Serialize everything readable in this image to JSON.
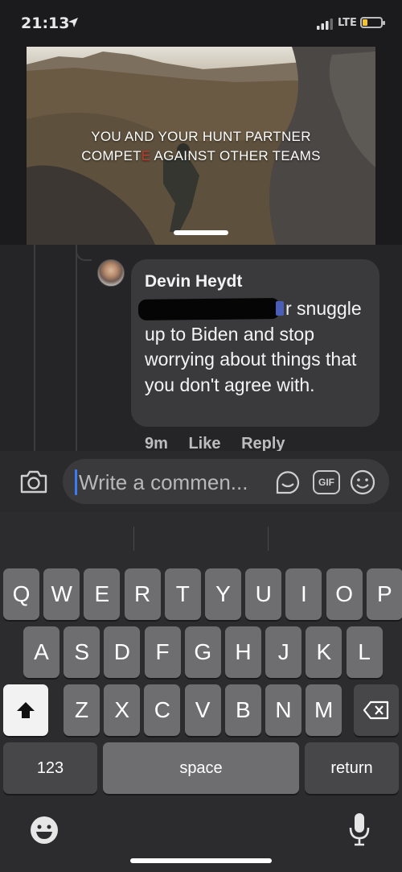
{
  "status": {
    "time": "21:13",
    "carrier": "LTE",
    "battery_level": 0.25,
    "battery_color": "#f3c42e",
    "location_icon": "location-arrow-icon",
    "signal_icon": "cell-signal-icon"
  },
  "video": {
    "caption_line1": "YOU AND YOUR HUNT PARTNER",
    "caption_line2_a": "COMPET",
    "caption_line2_red": "E",
    "caption_line2_b": " AGAINST OTHER TEAMS",
    "progress_fraction": 0.5
  },
  "comment": {
    "author": "Devin Heydt",
    "text": "r snuggle up to Biden and stop worrying about things that you don't agree with.",
    "time": "9m",
    "like_label": "Like",
    "reply_label": "Reply"
  },
  "composer": {
    "placeholder": "Write a commen...",
    "gif_label": "GIF",
    "camera_icon": "camera-icon",
    "sticker_icon": "sticker-icon",
    "emoji_icon": "smiley-icon"
  },
  "keyboard": {
    "row1": [
      "Q",
      "W",
      "E",
      "R",
      "T",
      "Y",
      "U",
      "I",
      "O",
      "P"
    ],
    "row2": [
      "A",
      "S",
      "D",
      "F",
      "G",
      "H",
      "J",
      "K",
      "L"
    ],
    "row3": [
      "Z",
      "X",
      "C",
      "V",
      "B",
      "N",
      "M"
    ],
    "numbers_label": "123",
    "space_label": "space",
    "return_label": "return",
    "shift_icon": "shift-icon",
    "delete_icon": "backspace-icon",
    "emoji_icon": "emoji-icon",
    "mic_icon": "microphone-icon"
  },
  "colors": {
    "accent": "#3d7bf4",
    "background": "#1b1b1d",
    "bubble": "#3a3a3d"
  }
}
